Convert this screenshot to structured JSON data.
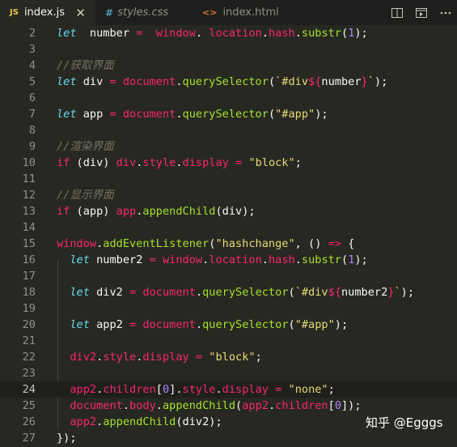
{
  "tabs": [
    {
      "icon": "JS",
      "label": "index.js",
      "close": "✕",
      "active": true,
      "icon_color": "#e8c94b"
    },
    {
      "icon": "#",
      "label": "styles.css",
      "active": false,
      "icon_color": "#519aba"
    },
    {
      "icon": "<>",
      "label": "index.html",
      "active": false,
      "icon_color": "#e37933"
    }
  ],
  "current_line": "24",
  "watermark": "知乎 @Egggs",
  "lines": [
    {
      "n": "2",
      "t": [
        [
          "k",
          "let"
        ],
        [
          "",
          "  number "
        ],
        [
          "r",
          "="
        ],
        [
          "r",
          "  window"
        ],
        [
          "",
          ". "
        ],
        [
          "r",
          "location"
        ],
        [
          "",
          "."
        ],
        [
          "r",
          "hash"
        ],
        [
          "",
          "."
        ],
        [
          "f",
          "substr"
        ],
        [
          "",
          "("
        ],
        [
          "n",
          "1"
        ],
        [
          "",
          ");"
        ]
      ]
    },
    {
      "n": "3",
      "t": []
    },
    {
      "n": "4",
      "t": [
        [
          "c",
          "//获取界面"
        ]
      ]
    },
    {
      "n": "5",
      "t": [
        [
          "k",
          "let"
        ],
        [
          "",
          " div "
        ],
        [
          "r",
          "="
        ],
        [
          "",
          " "
        ],
        [
          "r",
          "document"
        ],
        [
          "",
          "."
        ],
        [
          "f",
          "querySelector"
        ],
        [
          "",
          "("
        ],
        [
          "s",
          "`#div"
        ],
        [
          "r",
          "${"
        ],
        [
          "",
          "number"
        ],
        [
          "r",
          "}"
        ],
        [
          "s",
          "`"
        ],
        [
          "",
          ");"
        ]
      ]
    },
    {
      "n": "6",
      "t": []
    },
    {
      "n": "7",
      "t": [
        [
          "k",
          "let"
        ],
        [
          "",
          " app "
        ],
        [
          "r",
          "="
        ],
        [
          "",
          " "
        ],
        [
          "r",
          "document"
        ],
        [
          "",
          "."
        ],
        [
          "f",
          "querySelector"
        ],
        [
          "",
          "("
        ],
        [
          "s",
          "\"#app\""
        ],
        [
          "",
          ");"
        ]
      ]
    },
    {
      "n": "8",
      "t": []
    },
    {
      "n": "9",
      "t": [
        [
          "c",
          "//渲染界面"
        ]
      ]
    },
    {
      "n": "10",
      "t": [
        [
          "r",
          "if"
        ],
        [
          "",
          " (div) "
        ],
        [
          "r",
          "div"
        ],
        [
          "",
          "."
        ],
        [
          "r",
          "style"
        ],
        [
          "",
          "."
        ],
        [
          "r",
          "display"
        ],
        [
          "",
          " "
        ],
        [
          "r",
          "="
        ],
        [
          "",
          " "
        ],
        [
          "s",
          "\"block\""
        ],
        [
          "",
          ";"
        ]
      ]
    },
    {
      "n": "11",
      "t": []
    },
    {
      "n": "12",
      "t": [
        [
          "c",
          "//显示界面"
        ]
      ]
    },
    {
      "n": "13",
      "t": [
        [
          "r",
          "if"
        ],
        [
          "",
          " (app) "
        ],
        [
          "r",
          "app"
        ],
        [
          "",
          "."
        ],
        [
          "f",
          "appendChild"
        ],
        [
          "",
          "(div);"
        ]
      ]
    },
    {
      "n": "14",
      "t": []
    },
    {
      "n": "15",
      "t": [
        [
          "r",
          "window"
        ],
        [
          "",
          "."
        ],
        [
          "f",
          "addEventListener"
        ],
        [
          "",
          "("
        ],
        [
          "s",
          "\"hashchange\""
        ],
        [
          "",
          ", () "
        ],
        [
          "r",
          "=>"
        ],
        [
          "",
          " {"
        ]
      ]
    },
    {
      "n": "16",
      "t": [
        [
          "",
          "  "
        ],
        [
          "k",
          "let"
        ],
        [
          "",
          " number2 "
        ],
        [
          "r",
          "="
        ],
        [
          "",
          " "
        ],
        [
          "r",
          "window"
        ],
        [
          "",
          "."
        ],
        [
          "r",
          "location"
        ],
        [
          "",
          "."
        ],
        [
          "r",
          "hash"
        ],
        [
          "",
          "."
        ],
        [
          "f",
          "substr"
        ],
        [
          "",
          "("
        ],
        [
          "n",
          "1"
        ],
        [
          "",
          ");"
        ]
      ]
    },
    {
      "n": "17",
      "t": []
    },
    {
      "n": "18",
      "t": [
        [
          "",
          "  "
        ],
        [
          "k",
          "let"
        ],
        [
          "",
          " div2 "
        ],
        [
          "r",
          "="
        ],
        [
          "",
          " "
        ],
        [
          "r",
          "document"
        ],
        [
          "",
          "."
        ],
        [
          "f",
          "querySelector"
        ],
        [
          "",
          "("
        ],
        [
          "s",
          "`#div"
        ],
        [
          "r",
          "${"
        ],
        [
          "",
          "number2"
        ],
        [
          "r",
          "}"
        ],
        [
          "s",
          "`"
        ],
        [
          "",
          ");"
        ]
      ]
    },
    {
      "n": "19",
      "t": []
    },
    {
      "n": "20",
      "t": [
        [
          "",
          "  "
        ],
        [
          "k",
          "let"
        ],
        [
          "",
          " app2 "
        ],
        [
          "r",
          "="
        ],
        [
          "",
          " "
        ],
        [
          "r",
          "document"
        ],
        [
          "",
          "."
        ],
        [
          "f",
          "querySelector"
        ],
        [
          "",
          "("
        ],
        [
          "s",
          "\"#app\""
        ],
        [
          "",
          ");"
        ]
      ]
    },
    {
      "n": "21",
      "t": []
    },
    {
      "n": "22",
      "t": [
        [
          "",
          "  "
        ],
        [
          "r",
          "div2"
        ],
        [
          "",
          "."
        ],
        [
          "r",
          "style"
        ],
        [
          "",
          "."
        ],
        [
          "r",
          "display"
        ],
        [
          "",
          " "
        ],
        [
          "r",
          "="
        ],
        [
          "",
          " "
        ],
        [
          "s",
          "\"block\""
        ],
        [
          "",
          ";"
        ]
      ]
    },
    {
      "n": "23",
      "t": []
    },
    {
      "n": "24",
      "t": [
        [
          "",
          "  "
        ],
        [
          "r",
          "app2"
        ],
        [
          "",
          "."
        ],
        [
          "r",
          "children"
        ],
        [
          "",
          "["
        ],
        [
          "n",
          "0"
        ],
        [
          "",
          "]."
        ],
        [
          "r",
          "style"
        ],
        [
          "",
          "."
        ],
        [
          "r",
          "display"
        ],
        [
          "",
          " "
        ],
        [
          "r",
          "="
        ],
        [
          "",
          " "
        ],
        [
          "s",
          "\"none\""
        ],
        [
          "",
          ";"
        ]
      ]
    },
    {
      "n": "25",
      "t": [
        [
          "",
          "  "
        ],
        [
          "r",
          "document"
        ],
        [
          "",
          "."
        ],
        [
          "r",
          "body"
        ],
        [
          "",
          "."
        ],
        [
          "f",
          "appendChild"
        ],
        [
          "",
          "("
        ],
        [
          "r",
          "app2"
        ],
        [
          "",
          "."
        ],
        [
          "r",
          "children"
        ],
        [
          "",
          "["
        ],
        [
          "n",
          "0"
        ],
        [
          "",
          "]);"
        ]
      ]
    },
    {
      "n": "26",
      "t": [
        [
          "",
          "  "
        ],
        [
          "r",
          "app2"
        ],
        [
          "",
          "."
        ],
        [
          "f",
          "appendChild"
        ],
        [
          "",
          "(div2);"
        ]
      ]
    },
    {
      "n": "27",
      "t": [
        [
          "",
          "});"
        ]
      ]
    }
  ]
}
